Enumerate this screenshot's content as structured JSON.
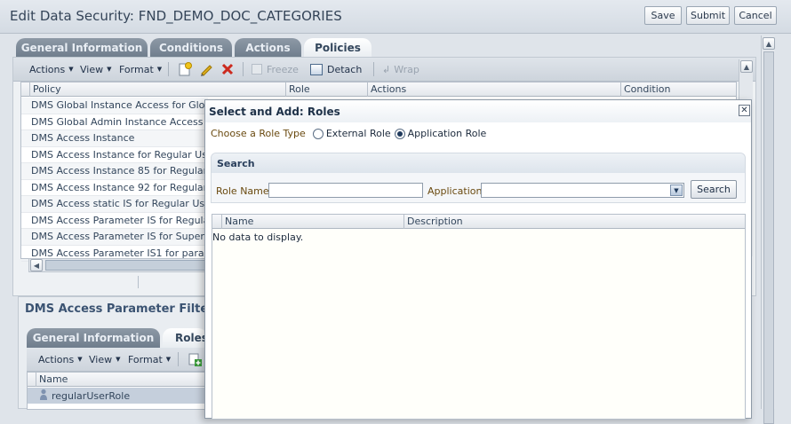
{
  "page": {
    "title": "Edit Data Security: FND_DEMO_DOC_CATEGORIES",
    "buttons": {
      "save": "Save",
      "submit": "Submit",
      "cancel": "Cancel"
    }
  },
  "tabs": [
    {
      "label": "General Information",
      "active": false
    },
    {
      "label": "Conditions",
      "active": false
    },
    {
      "label": "Actions",
      "active": false
    },
    {
      "label": "Policies",
      "active": true
    }
  ],
  "policies_toolbar": {
    "actions": "Actions",
    "view": "View",
    "format": "Format",
    "freeze": "Freeze",
    "detach": "Detach",
    "wrap": "Wrap"
  },
  "policies_table": {
    "columns": [
      "Policy",
      "Role",
      "Actions",
      "Condition"
    ],
    "rows": [
      "DMS Global Instance Access for Global Do",
      "DMS Global Admin Instance Access for Gl",
      "DMS Access Instance",
      "DMS Access Instance for Regular User Ro",
      "DMS Access Instance 85 for Regular Use",
      "DMS Access Instance 92 for Regular Use",
      "DMS Access static IS for Regular User Ro",
      "DMS Access Parameter IS for Regular Us",
      "DMS Access Parameter IS for Super User",
      "DMS Access Parameter IS1 for param1 v"
    ]
  },
  "detail": {
    "title": "DMS Access Parameter Filter1 for",
    "tabs": [
      {
        "label": "General Information",
        "active": false
      },
      {
        "label": "Roles",
        "active": true
      }
    ],
    "toolbar": {
      "actions": "Actions",
      "view": "View",
      "format": "Format"
    },
    "table": {
      "columns": [
        "Name"
      ],
      "rows": [
        "regularUserRole"
      ]
    }
  },
  "dialog": {
    "title": "Select and Add: Roles",
    "role_type_label": "Choose a Role Type",
    "role_types": [
      {
        "label": "External Role",
        "selected": false
      },
      {
        "label": "Application Role",
        "selected": true
      }
    ],
    "search": {
      "header": "Search",
      "role_name_label": "Role Name",
      "role_name_value": "",
      "application_label": "Application",
      "application_value": "",
      "button": "Search"
    },
    "results": {
      "columns": [
        "Name",
        "Description"
      ],
      "empty_text": "No data to display."
    }
  },
  "icons": [
    "new-icon",
    "edit-pencil-icon",
    "delete-x-icon",
    "freeze-icon",
    "detach-icon",
    "wrap-icon",
    "add-role-icon",
    "close-icon",
    "user-icon",
    "scroll-up-icon",
    "scroll-down-icon",
    "scroll-left-icon",
    "dropdown-arrow-icon"
  ],
  "colors": {
    "accent": "#33465c",
    "label": "#6a4a10",
    "delete": "#cc2a1e",
    "edit": "#d4a017"
  }
}
